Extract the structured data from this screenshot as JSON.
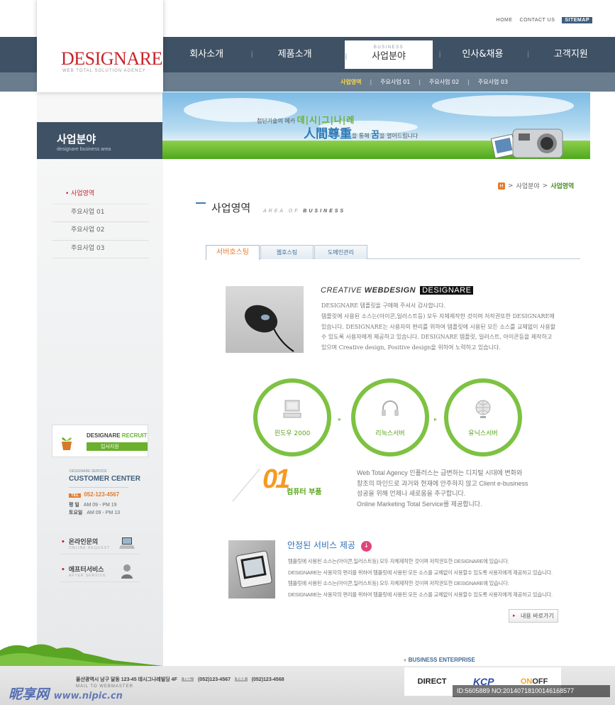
{
  "utility": {
    "home": "HOME",
    "contact": "CONTACT US",
    "sitemap": "SITEMAP"
  },
  "brand": {
    "logo": "DESIGNARE",
    "tagline": "WEB TOTAL SOLUTION AGENCY",
    "color": "#c8242b"
  },
  "nav": {
    "items": [
      "회사소개",
      "제품소개",
      "사업분야",
      "인사&채용",
      "고객지원"
    ],
    "active_index": 2,
    "active_caption": "BUSINESS",
    "submenu": [
      "사업영역",
      "주요사업 01",
      "주요사업 02",
      "주요사업 03"
    ],
    "submenu_sep": "|"
  },
  "sidebar": {
    "title": "사업분야",
    "subtitle": "designare business area",
    "items": [
      "사업영역",
      "주요사업 01",
      "주요사업 02",
      "주요사업 03"
    ],
    "recruit": {
      "line1": "DESIGNARE",
      "line1_hl": "RECRUIT",
      "button": "입사지원"
    },
    "customer": {
      "label": "DESIGNARE SERVICE",
      "title": "CUSTOMER CENTER",
      "tel_badge": "TEL",
      "tel": "052-123-4567",
      "weekday_label": "평  일",
      "weekday_hours": "AM 09 - PM 19",
      "sat_label": "토요일",
      "sat_hours": "AM 09 - PM 13"
    },
    "links": [
      {
        "title": "온라인문의",
        "sub": "ONLINE REQUEST"
      },
      {
        "title": "애프터서비스",
        "sub": "AFTER SERVICE"
      }
    ]
  },
  "banner": {
    "line1_pre": "첨단기술의 메카",
    "line1_hl": "데|시|그|나|레",
    "line2_big": "人間尊重",
    "line2_mid1": "을 통해",
    "line2_dream": "꿈",
    "line2_post": "을 열어드립니다"
  },
  "breadcrumb": {
    "home": "H",
    "parent": "사업분야",
    "current": "사업영역",
    "sep": ">"
  },
  "page": {
    "title": "사업영역",
    "en_pre": "AREA OF",
    "en_bold": "BUSINESS"
  },
  "tabs": [
    "서버호스팅",
    "웹호스팅",
    "도메인관리"
  ],
  "section1": {
    "heading_italic": "CREATIVE",
    "heading_bold": "WEBDESIGN",
    "heading_brand": "DESIGNARE",
    "lines": [
      "DESIGNARE 템플릿을 구매해 주셔서 감사합니다.",
      "템플릿에 사용된 소스는(아이콘,일러스트등) 모두 자체제작한 것이며 저작권또한 DESIGNARE에",
      "있습니다. DESIGNARE는 사용자의 편리를 위하여 템플릿에 사용된 모든 소스를 교체없이 사용할",
      "수 있도록 사용자에게 제공하고 있습니다. DESIGNARE 템플릿, 일러스트, 아이콘등을 제작하고",
      "있으며 Creative design, Positive design을 위하여 노력하고 있습니다."
    ]
  },
  "process": {
    "steps": [
      "윈도우 2000",
      "리눅스서버",
      "유닉스서버"
    ],
    "arrow": "▸",
    "accent": "#7dc242"
  },
  "section2": {
    "number": "01",
    "label": "컴퓨터 부품",
    "lines": [
      "Web Total Agency 인플러스는 급변하는 디지털 시대에 변화와",
      "창조의 마인드로 과거와 현재에 안주하지 않고 Client e-business",
      "성공을 위해 언제나 새로움을 추구합니다.",
      "Online Marketing Total Service를 제공합니다."
    ]
  },
  "section3": {
    "title": "안정된 서비스 제공",
    "title_icon": "↓",
    "lines": [
      "템플릿에 사용된 소스는(아이콘,일러스트등) 모두 자체제작한 것이며 저작권또한 DESIGNARE에 있습니다.",
      "DESIGNARE는 사용자의 편리를 위하여 템플릿에 사용된 모든 소스를 교체없이 사용할수 있도록 사용자에게 제공하고 있습니다.",
      "템플릿에 사용된 소스는(아이콘,일러스트등) 모두 자체제작한 것이며 저작권또한 DESIGNARE에 있습니다.",
      "DESIGNARE는 사용자의 편리를 위하여 템플릿에 사용된 모든 소스를 교체없이 사용할수 있도록 사용자에게 제공하고 있습니다."
    ],
    "more_button": "내용 바로가기"
  },
  "footer": {
    "enterprise": "BUSINESS ENTERPRISE",
    "address": "울산광역시 남구 달동 123-45 데시그나레빌딩 4F",
    "tel_tag": "TEL",
    "tel": "(052)123-4567",
    "fax_tag": "FAX",
    "fax": "(052)123-4568",
    "mail": "MAIL TO WEBMASTER",
    "partners": [
      "DIRECT",
      "KCP",
      "ON",
      "OFF"
    ]
  },
  "watermark": {
    "left_main": "昵享网",
    "left_url": "www.nipic.cn",
    "right": "ID:5605889 NO:20140718100146168577"
  }
}
